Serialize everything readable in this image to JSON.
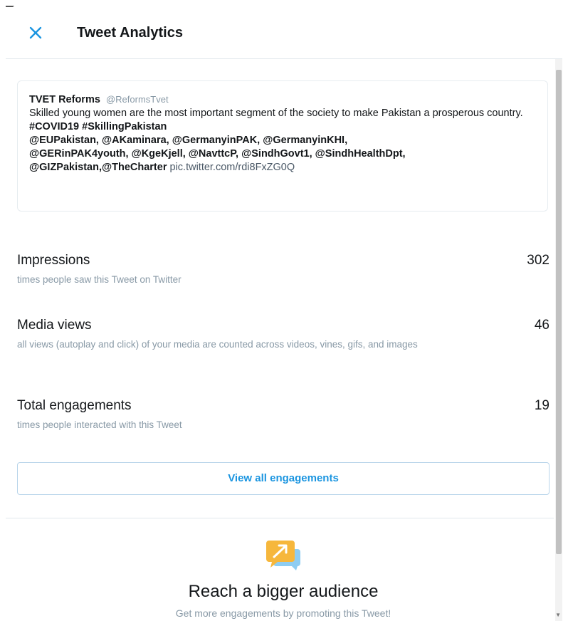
{
  "header": {
    "title": "Tweet Analytics",
    "close_icon": "close-icon"
  },
  "tweet": {
    "author_name": "TVET Reforms",
    "author_handle": "@ReformsTvet",
    "text": "Skilled young women are the most important segment of the society to make Pakistan a prosperous country.",
    "hashtags": "#COVID19 #SkillingPakistan",
    "mentions_line1": "@EUPakistan, @AKaminara, @GermanyinPAK, @GermanyinKHI,",
    "mentions_line2": "@GERinPAK4youth, @KgeKjell, @NavttcP, @SindhGovt1, @SindhHealthDpt,",
    "mentions_line3": "@GIZPakistan,@TheCharter",
    "pic_link": "pic.twitter.com/rdi8FxZG0Q"
  },
  "metrics": [
    {
      "label": "Impressions",
      "value": "302",
      "description": "times people saw this Tweet on Twitter"
    },
    {
      "label": "Media views",
      "value": "46",
      "description": "all views (autoplay and click) of your media are counted across videos, vines, gifs, and images"
    },
    {
      "label": "Total engagements",
      "value": "19",
      "description": "times people interacted with this Tweet"
    }
  ],
  "view_all_button": "View all engagements",
  "promo": {
    "icon": "promote-chat-icon",
    "title": "Reach a bigger audience",
    "subtitle": "Get more engagements by promoting this Tweet!"
  },
  "colors": {
    "accent": "#1b95e0",
    "promo_icon_orange": "#f6b73c",
    "promo_icon_blue": "#8ecdf2",
    "muted_text": "#8899a6"
  }
}
